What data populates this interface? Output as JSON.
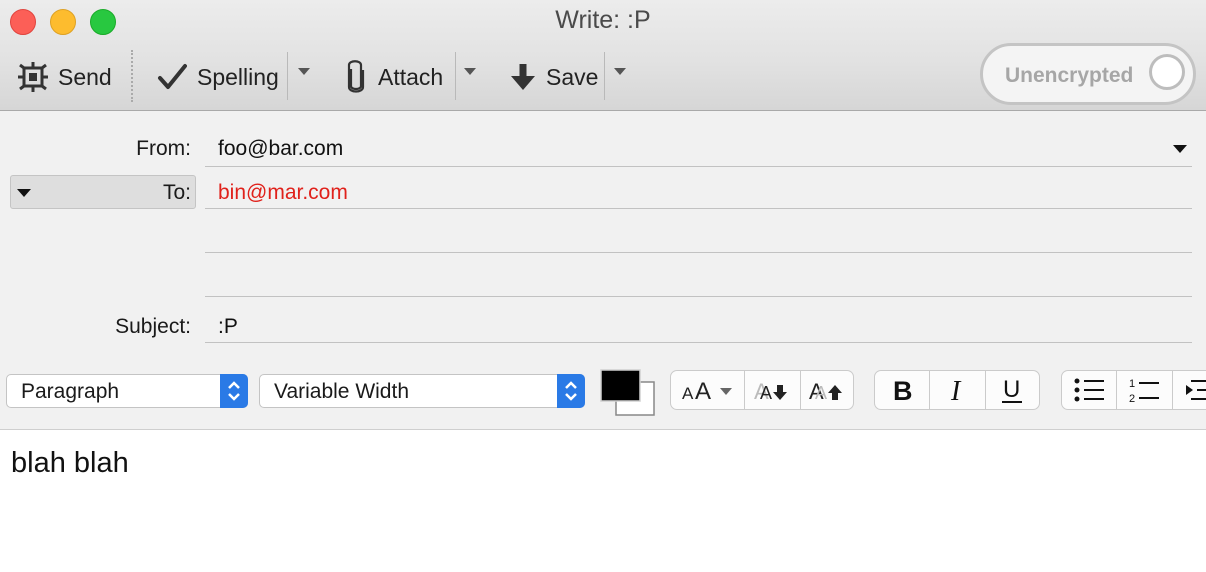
{
  "window": {
    "title": "Write: :P"
  },
  "toolbar": {
    "send_label": "Send",
    "spelling_label": "Spelling",
    "attach_label": "Attach",
    "save_label": "Save",
    "encryption_label": "Unencrypted",
    "icons": [
      "send-icon",
      "checkmark-icon",
      "paperclip-icon",
      "download-arrow-icon"
    ]
  },
  "header": {
    "from_label": "From:",
    "from_value": "foo@bar.com",
    "to_label": "To:",
    "to_value": "bin@mar.com",
    "subject_label": "Subject:",
    "subject_value": ":P"
  },
  "format": {
    "paragraph_style": "Paragraph",
    "font_family": "Variable Width",
    "text_color": "#000000",
    "background_color": "#ffffff"
  },
  "body": {
    "text": "blah blah"
  },
  "colors": {
    "recipient": "#e0211b",
    "accent": "#2a7ae6"
  }
}
